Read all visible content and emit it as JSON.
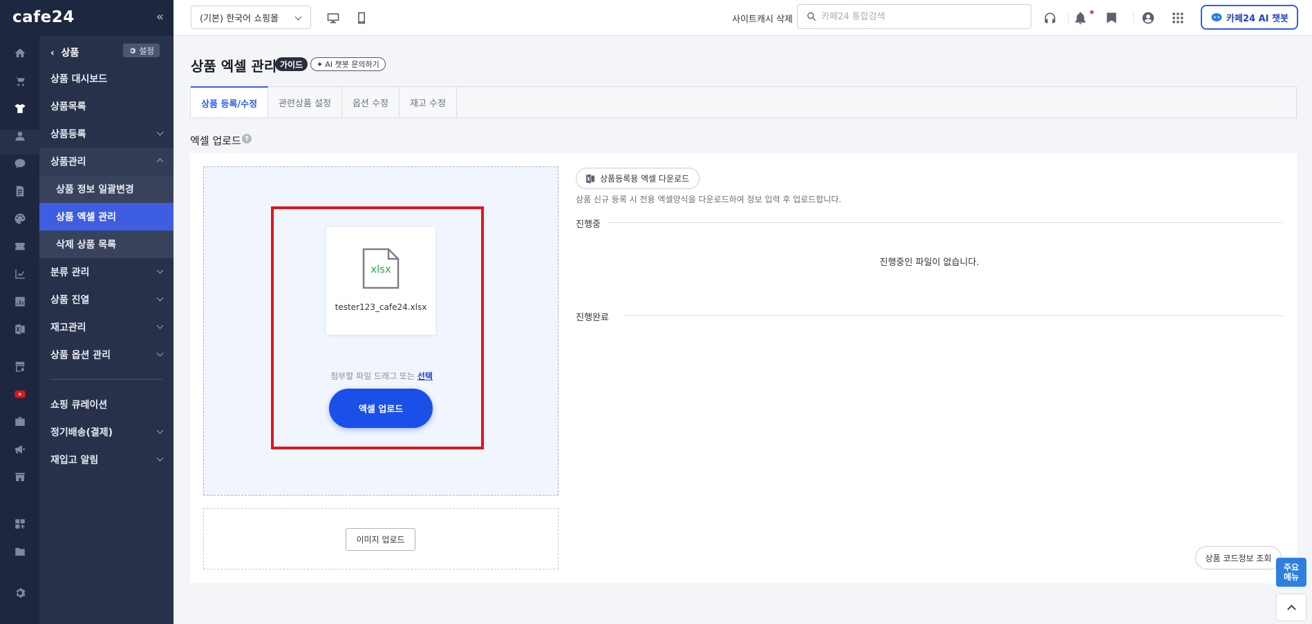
{
  "brand": {
    "logo": "cafe24",
    "accent": "#2f5de8",
    "sidebar_bg": "#28314a"
  },
  "sidebar": {
    "collapse_icon": "double-chevron-left-icon",
    "rail_icons": [
      "home-icon",
      "cart-icon",
      "tshirt-icon",
      "person-icon",
      "chat-icon",
      "document-icon",
      "palette-icon",
      "ticket-icon",
      "chart-icon",
      "bar-chart-icon",
      "excel-icon",
      "store-settings-icon",
      "youtube-icon",
      "briefcase-icon",
      "megaphone-icon",
      "store-icon",
      "apps-add-icon",
      "folder-icon",
      "gear-icon"
    ],
    "header": "상품",
    "settings_label": "설정",
    "items": [
      {
        "label": "상품 대시보드"
      },
      {
        "label": "상품목록"
      },
      {
        "label": "상품등록"
      },
      {
        "label": "상품관리"
      },
      {
        "label": "상품 정보 일괄변경"
      },
      {
        "label": "상품 엑셀 관리"
      },
      {
        "label": "삭제 상품 목록"
      },
      {
        "label": "분류 관리"
      },
      {
        "label": "상품 진열"
      },
      {
        "label": "재고관리"
      },
      {
        "label": "상품 옵션 관리"
      },
      {
        "label": "쇼핑 큐레이션"
      },
      {
        "label": "정기배송(결제)"
      },
      {
        "label": "재입고 알림"
      }
    ]
  },
  "topbar": {
    "store_select": "(기본) 한국어 쇼핑몰",
    "cache_link": "사이트캐시 삭제",
    "search_placeholder": "카페24 통합검색",
    "chatbot_label": "카페24 AI 챗봇"
  },
  "page": {
    "title": "상품 엑셀 관리",
    "guide_badge": "가이드",
    "ai_ask": "AI 챗봇 문의하기",
    "tabs": [
      "상품 등록/수정",
      "관련상품 설정",
      "옵션 수정",
      "재고 수정"
    ],
    "section_title": "엑셀 업로드",
    "help": "?"
  },
  "upload": {
    "file_type": "xlsx",
    "file_name": "tester123_cafe24.xlsx",
    "drop_hint": "첨부할 파일 드래그 또는",
    "drop_link": "선택",
    "excel_upload_btn": "엑셀 업로드",
    "image_upload_btn": "이미지 업로드"
  },
  "status": {
    "download_btn": "상품등록용 엑셀 다운로드",
    "download_desc": "상품 신규 등록 시 전용 엑셀양식을 다운로드하여 정보 입력 후 업로드합니다.",
    "in_progress_label": "진행중",
    "in_progress_empty": "진행중인 파일이 없습니다.",
    "completed_label": "진행완료"
  },
  "footer": {
    "code_lookup_btn": "상품 코드정보 조회",
    "main_menu_line1": "주요",
    "main_menu_line2": "메뉴"
  }
}
